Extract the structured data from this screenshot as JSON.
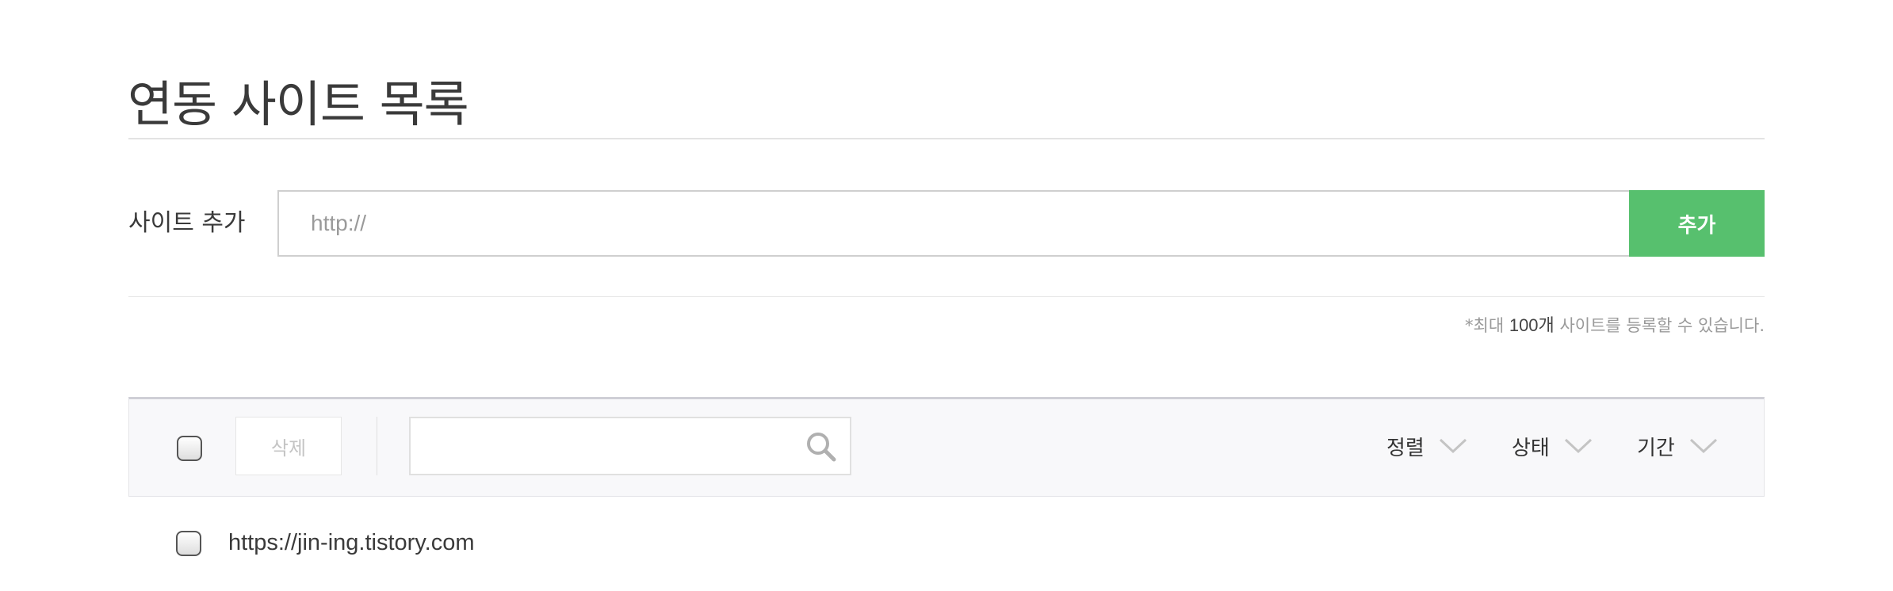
{
  "page": {
    "title": "연동 사이트 목록"
  },
  "add_site": {
    "label": "사이트 추가",
    "url_placeholder": "http://",
    "url_value": "",
    "button_label": "추가"
  },
  "limit_note": {
    "prefix": "*최대 ",
    "highlight": "100개",
    "suffix": " 사이트를 등록할 수 있습니다."
  },
  "toolbar": {
    "delete_label": "삭제",
    "search_value": "",
    "dropdowns": [
      {
        "label": "정렬"
      },
      {
        "label": "상태"
      },
      {
        "label": "기간"
      }
    ]
  },
  "sites": [
    {
      "url": "https://jin-ing.tistory.com"
    }
  ],
  "colors": {
    "accent": "#57c06e",
    "toolbar_bg": "#f8f8fa",
    "text": "#333333",
    "muted": "#9a9a9a"
  },
  "icons": {
    "search": "search-icon",
    "dropdown": "chevron-down-icon"
  }
}
